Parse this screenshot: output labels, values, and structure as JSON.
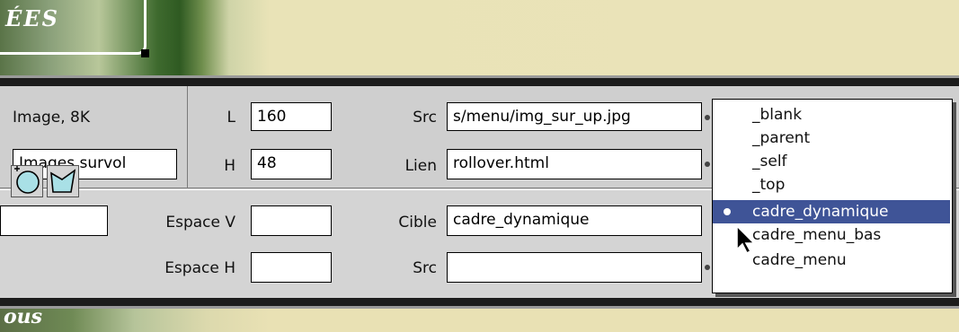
{
  "banner": {
    "logo_text": "ÉES",
    "bottom_text": "ous"
  },
  "properties": {
    "image_size": "Image, 8K",
    "image_name": "Images survol",
    "width_label": "L",
    "width_value": "160",
    "height_label": "H",
    "height_value": "48",
    "src_label": "Src",
    "src_value": "s/menu/img_sur_up.jpg",
    "link_label": "Lien",
    "link_value": "rollover.html",
    "vspace_label": "Espace V",
    "vspace_value": "",
    "hspace_label": "Espace H",
    "hspace_value": "",
    "target_label": "Cible",
    "target_value": "cadre_dynamique",
    "src2_label": "Src",
    "src2_value": ""
  },
  "target_menu": {
    "items": [
      "_blank",
      "_parent",
      "_self",
      "_top",
      "cadre_dynamique",
      "cadre_menu_bas",
      "cadre_menu"
    ],
    "selected": "cadre_dynamique"
  },
  "colors": {
    "selection": "#3f5497",
    "panel": "#d4d4d4",
    "background": "#e9e1b4"
  }
}
